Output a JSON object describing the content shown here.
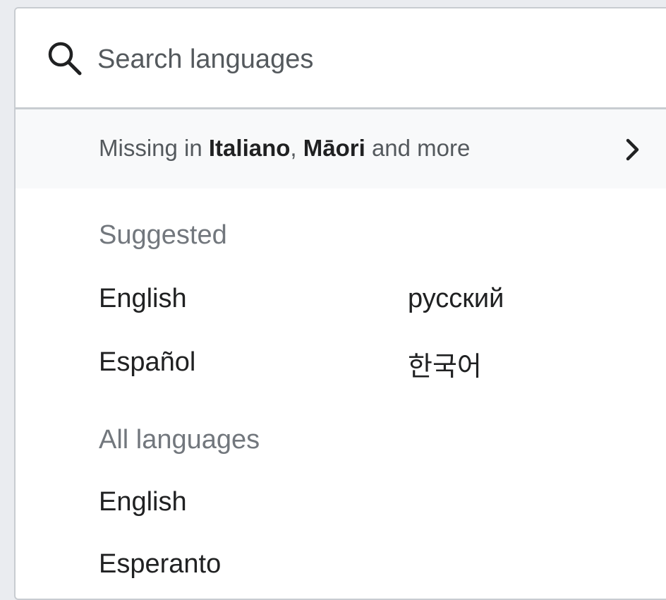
{
  "search": {
    "placeholder": "Search languages",
    "value": ""
  },
  "missing": {
    "prefix": "Missing in ",
    "lang1": "Italiano",
    "separator": ", ",
    "lang2": "Māori",
    "suffix": " and more"
  },
  "suggested": {
    "heading": "Suggested",
    "languages": [
      "English",
      "русский",
      "Español",
      "한국어"
    ]
  },
  "all_languages": {
    "heading": "All languages",
    "languages": [
      "English",
      "Esperanto"
    ]
  },
  "icons": {
    "search": "search-icon",
    "chevron": "chevron-right-icon"
  }
}
